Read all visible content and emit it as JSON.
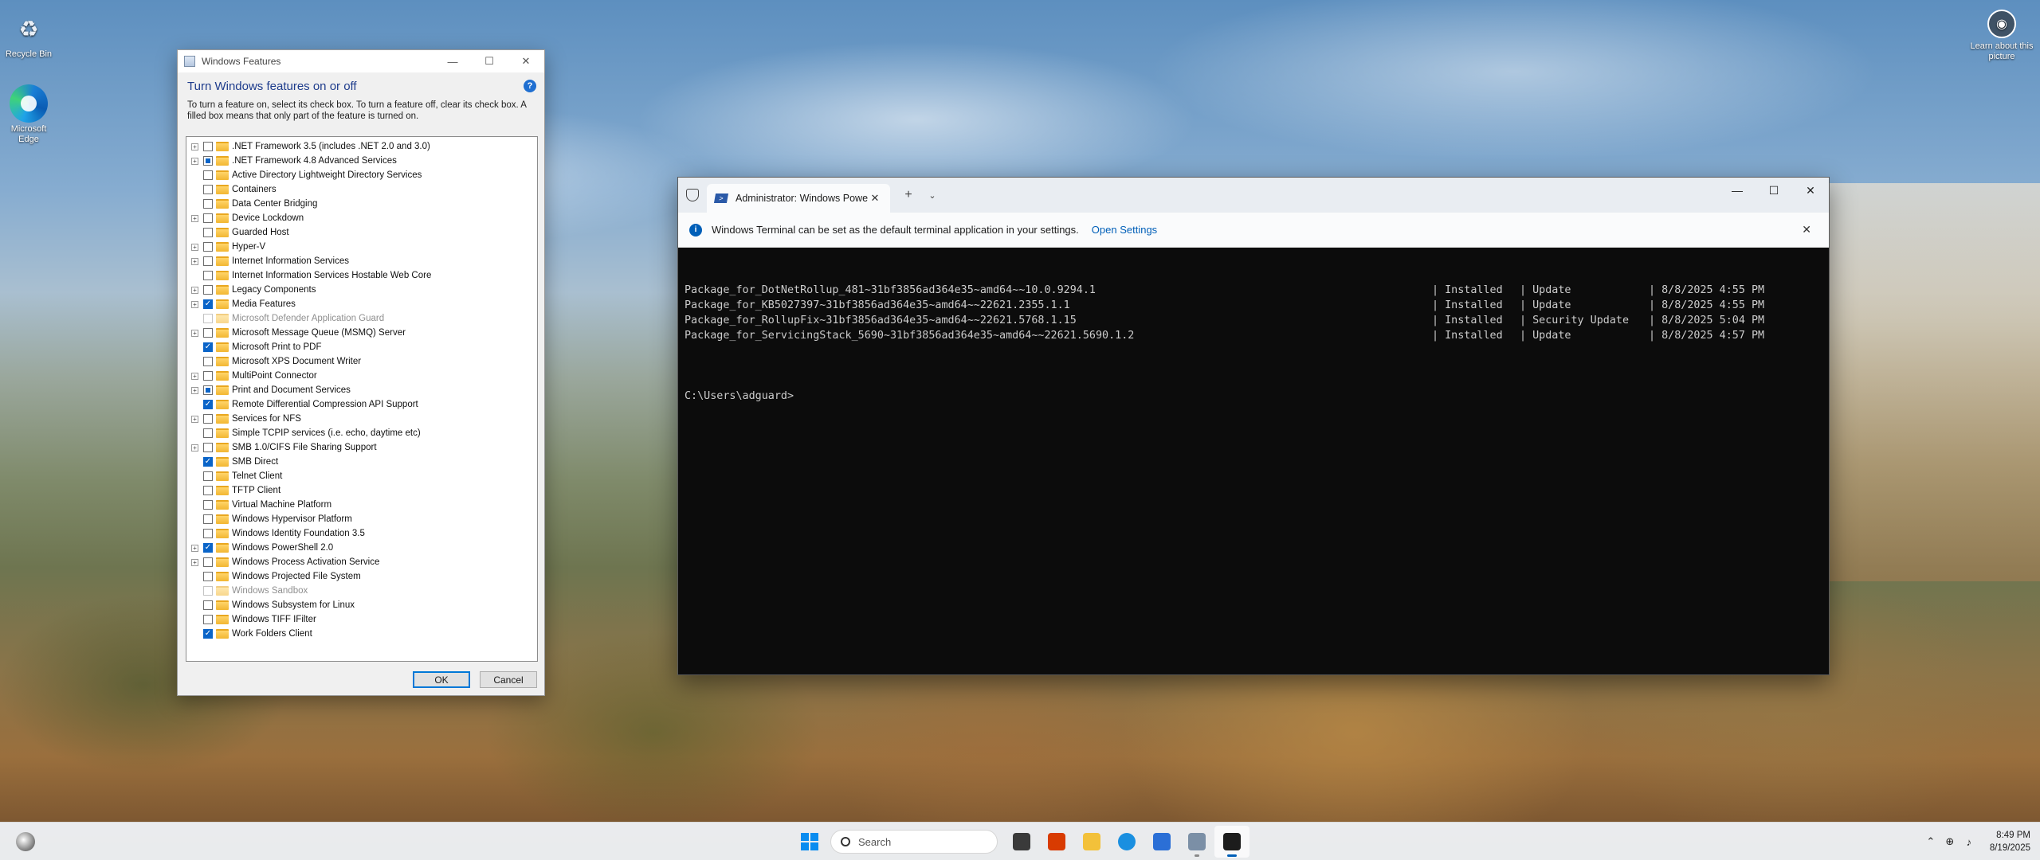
{
  "desktop": {
    "icons": [
      {
        "label": "Recycle Bin",
        "icon": "recycle-bin-icon"
      },
      {
        "label": "Microsoft Edge",
        "icon": "edge-icon"
      }
    ],
    "learn_picture": "Learn about this picture"
  },
  "windows_features": {
    "window_title": "Windows Features",
    "heading": "Turn Windows features on or off",
    "description": "To turn a feature on, select its check box. To turn a feature off, clear its check box. A filled box means that only part of the feature is turned on.",
    "ok_label": "OK",
    "cancel_label": "Cancel",
    "features": [
      {
        "label": ".NET Framework 3.5 (includes .NET 2.0 and 3.0)",
        "expandable": true,
        "state": "off"
      },
      {
        "label": ".NET Framework 4.8 Advanced Services",
        "expandable": true,
        "state": "partial"
      },
      {
        "label": "Active Directory Lightweight Directory Services",
        "expandable": false,
        "state": "off"
      },
      {
        "label": "Containers",
        "expandable": false,
        "state": "off"
      },
      {
        "label": "Data Center Bridging",
        "expandable": false,
        "state": "off"
      },
      {
        "label": "Device Lockdown",
        "expandable": true,
        "state": "off"
      },
      {
        "label": "Guarded Host",
        "expandable": false,
        "state": "off"
      },
      {
        "label": "Hyper-V",
        "expandable": true,
        "state": "off"
      },
      {
        "label": "Internet Information Services",
        "expandable": true,
        "state": "off"
      },
      {
        "label": "Internet Information Services Hostable Web Core",
        "expandable": false,
        "state": "off"
      },
      {
        "label": "Legacy Components",
        "expandable": true,
        "state": "off"
      },
      {
        "label": "Media Features",
        "expandable": true,
        "state": "on"
      },
      {
        "label": "Microsoft Defender Application Guard",
        "expandable": false,
        "state": "disabled"
      },
      {
        "label": "Microsoft Message Queue (MSMQ) Server",
        "expandable": true,
        "state": "off"
      },
      {
        "label": "Microsoft Print to PDF",
        "expandable": false,
        "state": "on"
      },
      {
        "label": "Microsoft XPS Document Writer",
        "expandable": false,
        "state": "off"
      },
      {
        "label": "MultiPoint Connector",
        "expandable": true,
        "state": "off"
      },
      {
        "label": "Print and Document Services",
        "expandable": true,
        "state": "partial"
      },
      {
        "label": "Remote Differential Compression API Support",
        "expandable": false,
        "state": "on"
      },
      {
        "label": "Services for NFS",
        "expandable": true,
        "state": "off"
      },
      {
        "label": "Simple TCPIP services (i.e. echo, daytime etc)",
        "expandable": false,
        "state": "off"
      },
      {
        "label": "SMB 1.0/CIFS File Sharing Support",
        "expandable": true,
        "state": "off"
      },
      {
        "label": "SMB Direct",
        "expandable": false,
        "state": "on"
      },
      {
        "label": "Telnet Client",
        "expandable": false,
        "state": "off"
      },
      {
        "label": "TFTP Client",
        "expandable": false,
        "state": "off"
      },
      {
        "label": "Virtual Machine Platform",
        "expandable": false,
        "state": "off"
      },
      {
        "label": "Windows Hypervisor Platform",
        "expandable": false,
        "state": "off"
      },
      {
        "label": "Windows Identity Foundation 3.5",
        "expandable": false,
        "state": "off"
      },
      {
        "label": "Windows PowerShell 2.0",
        "expandable": true,
        "state": "on"
      },
      {
        "label": "Windows Process Activation Service",
        "expandable": true,
        "state": "off"
      },
      {
        "label": "Windows Projected File System",
        "expandable": false,
        "state": "off"
      },
      {
        "label": "Windows Sandbox",
        "expandable": false,
        "state": "disabled"
      },
      {
        "label": "Windows Subsystem for Linux",
        "expandable": false,
        "state": "off"
      },
      {
        "label": "Windows TIFF IFilter",
        "expandable": false,
        "state": "off"
      },
      {
        "label": "Work Folders Client",
        "expandable": false,
        "state": "on"
      }
    ]
  },
  "terminal": {
    "tab_title": "Administrator: Windows Powe",
    "new_tab": "+",
    "infobar_text": "Windows Terminal can be set as the default terminal application in your settings.",
    "infobar_link": "Open Settings",
    "output_rows": [
      {
        "name": "Package_for_DotNetRollup_481~31bf3856ad364e35~amd64~~10.0.9294.1",
        "state": "| Installed",
        "type": "| Update",
        "date": "| 8/8/2025 4:55 PM"
      },
      {
        "name": "Package_for_KB5027397~31bf3856ad364e35~amd64~~22621.2355.1.1",
        "state": "| Installed",
        "type": "| Update",
        "date": "| 8/8/2025 4:55 PM"
      },
      {
        "name": "Package_for_RollupFix~31bf3856ad364e35~amd64~~22621.5768.1.15",
        "state": "| Installed",
        "type": "| Security Update",
        "date": "| 8/8/2025 5:04 PM"
      },
      {
        "name": "Package_for_ServicingStack_5690~31bf3856ad364e35~amd64~~22621.5690.1.2",
        "state": "| Installed",
        "type": "| Update",
        "date": "| 8/8/2025 4:57 PM"
      }
    ],
    "prompt": "C:\\Users\\adguard>"
  },
  "taskbar": {
    "search_placeholder": "Search",
    "time": "8:49 PM",
    "date": "8/19/2025",
    "colors": {
      "accent": "#005fb8",
      "start": "#0a8cf0"
    }
  }
}
